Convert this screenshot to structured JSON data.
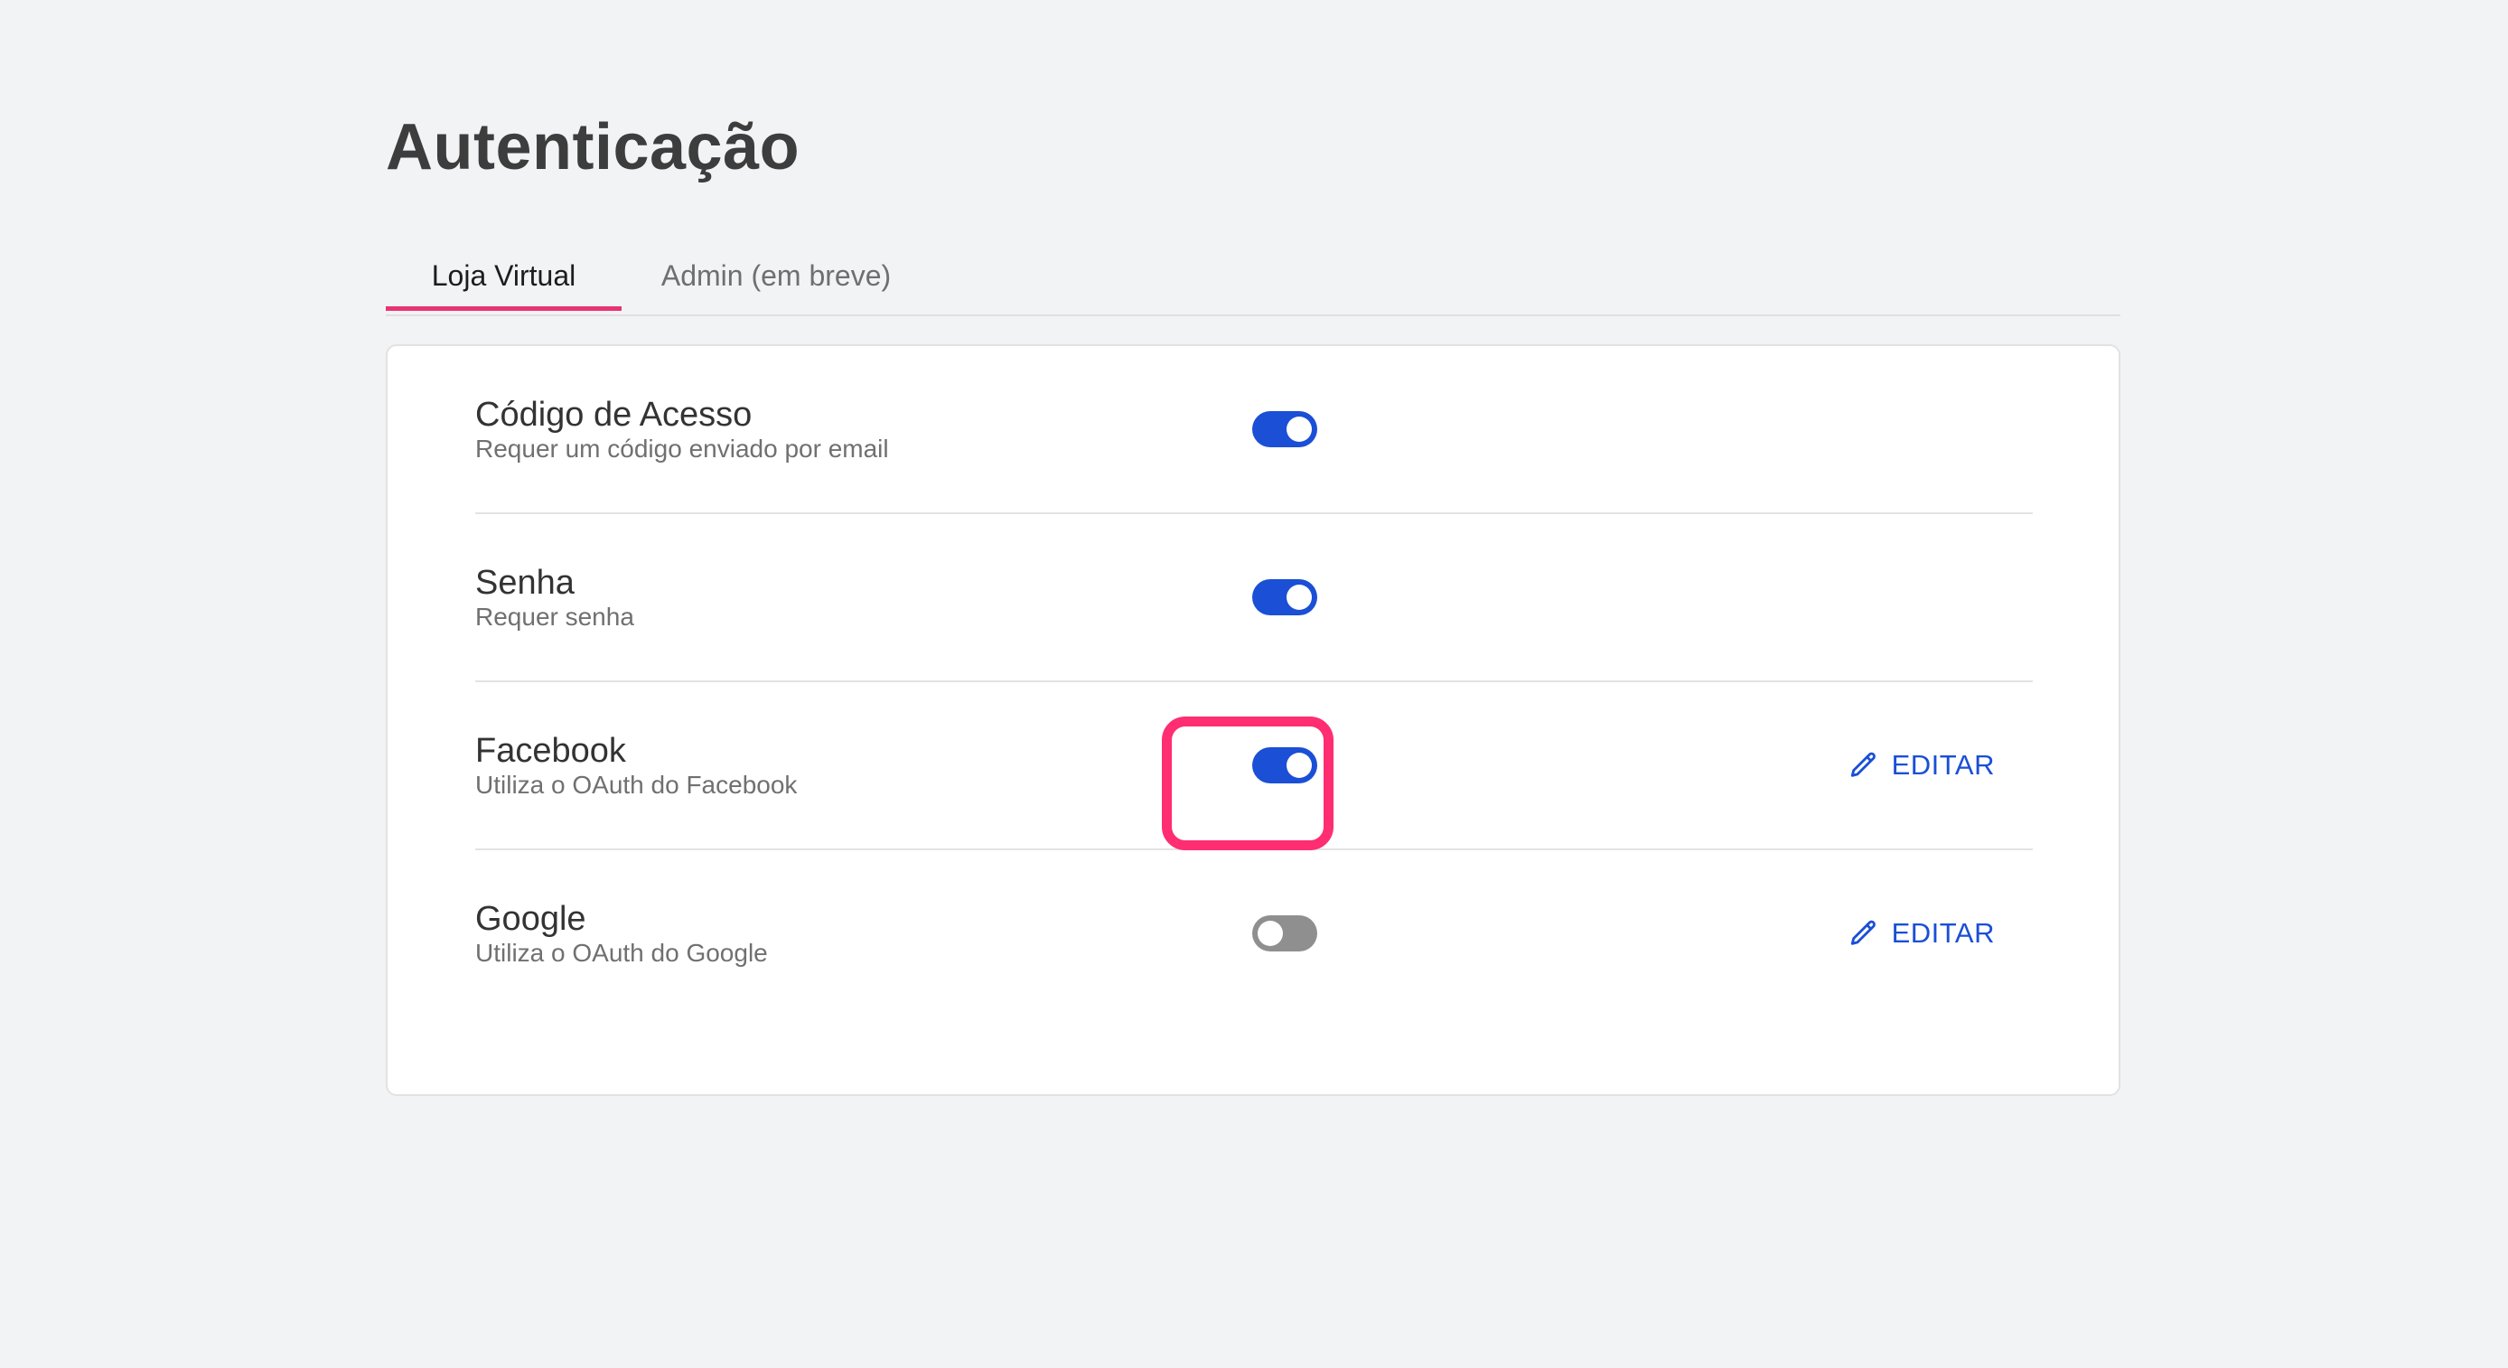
{
  "page": {
    "title": "Autenticação"
  },
  "tabs": [
    {
      "label": "Loja Virtual",
      "active": true
    },
    {
      "label": "Admin (em breve)",
      "active": false
    }
  ],
  "settings": [
    {
      "title": "Código de Acesso",
      "description": "Requer um código enviado por email",
      "enabled": true
    },
    {
      "title": "Senha",
      "description": "Requer senha",
      "enabled": true
    },
    {
      "title": "Facebook",
      "description": "Utiliza o OAuth do Facebook",
      "enabled": true,
      "edit_label": "EDITAR",
      "highlighted": true
    },
    {
      "title": "Google",
      "description": "Utiliza o OAuth do Google",
      "enabled": false,
      "edit_label": "EDITAR"
    }
  ],
  "colors": {
    "accent": "#1a4fd6",
    "tab_indicator": "#e8336f",
    "highlight": "#ff2d71",
    "toggle_off": "#8f8f8f",
    "background": "#f2f3f5"
  },
  "icons": {
    "edit": "pencil-icon"
  }
}
